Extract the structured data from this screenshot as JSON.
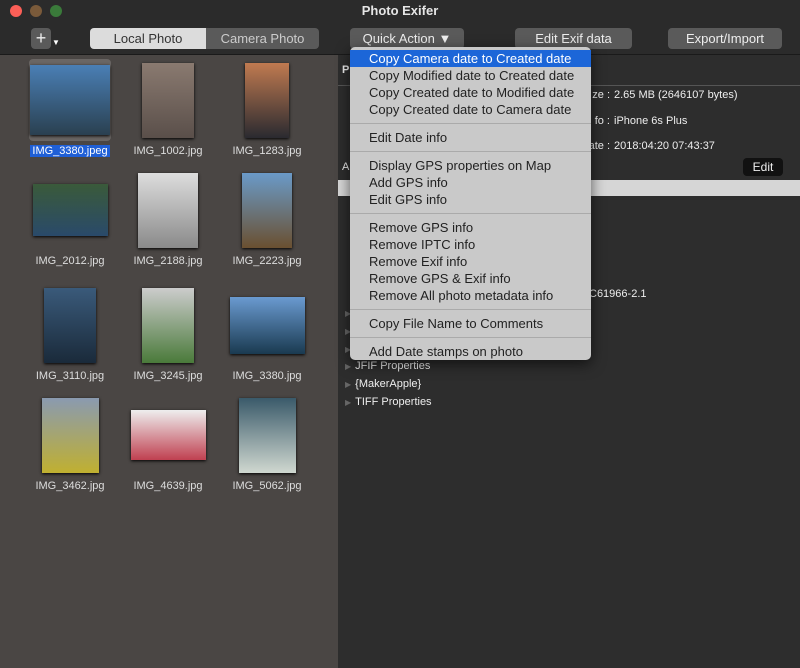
{
  "window": {
    "title": "Photo Exifer"
  },
  "toolbar": {
    "add_icon": "plus-icon",
    "tabs": [
      "Local Photo",
      "Camera Photo"
    ],
    "quick_action": "Quick Action ▼",
    "edit_exif": "Edit Exif data",
    "export_import": "Export/Import"
  },
  "photos": [
    {
      "name": "IMG_3380.jpeg",
      "selected": true
    },
    {
      "name": "IMG_1002.jpg"
    },
    {
      "name": "IMG_1283.jpg"
    },
    {
      "name": "IMG_2012.jpg"
    },
    {
      "name": "IMG_2188.jpg"
    },
    {
      "name": "IMG_2223.jpg"
    },
    {
      "name": "IMG_3110.jpg"
    },
    {
      "name": "IMG_3245.jpg"
    },
    {
      "name": "IMG_3380.jpg"
    },
    {
      "name": "IMG_3462.jpg"
    },
    {
      "name": "IMG_4639.jpg"
    },
    {
      "name": "IMG_5062.jpg"
    }
  ],
  "details": {
    "tab_fragment": "P",
    "section_fragment": "A",
    "rows": [
      {
        "label": "ze :",
        "value": "2.65 MB (2646107 bytes)"
      },
      {
        "label": "fo :",
        "value": "iPhone 6s Plus"
      },
      {
        "label": "ate :",
        "value": "2018:04:20 07:43:37"
      }
    ],
    "edit": "Edit",
    "profile_fragment": "C61966-2.1",
    "tree": [
      "JFIF Properties",
      "{MakerApple}",
      "TIFF Properties"
    ]
  },
  "menu": {
    "groups": [
      [
        "Copy Camera date to Created date",
        "Copy Modified date to Created date",
        "Copy Created date to Modified date",
        "Copy Created date to Camera date"
      ],
      [
        "Edit Date info"
      ],
      [
        "Display GPS properties on Map",
        "Add GPS info",
        "Edit GPS  info"
      ],
      [
        "Remove GPS info",
        "Remove IPTC info",
        "Remove Exif info",
        "Remove GPS & Exif info",
        "Remove All photo metadata info"
      ],
      [
        "Copy File Name to Comments"
      ],
      [
        "Add Date stamps on photo"
      ]
    ],
    "highlighted": "Copy Camera date to Created date"
  }
}
